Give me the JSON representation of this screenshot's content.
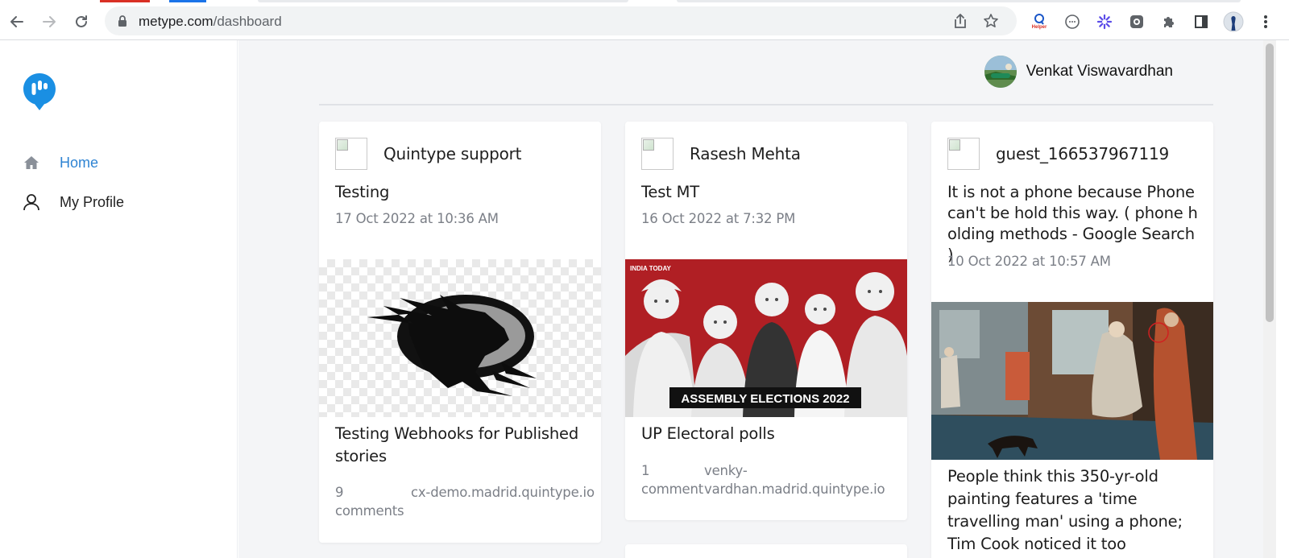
{
  "browser": {
    "url_domain": "metype.com",
    "url_path": "/dashboard",
    "ext_badge": "Helper"
  },
  "sidebar": {
    "items": [
      {
        "label": "Home",
        "icon": "home-icon",
        "active": true
      },
      {
        "label": "My Profile",
        "icon": "user-icon",
        "active": false
      }
    ]
  },
  "header": {
    "user_name": "Venkat Viswavardhan"
  },
  "cards": [
    {
      "author": "Quintype support",
      "title": "Testing",
      "date": "17 Oct 2022 at 10:36 AM",
      "story_title": "Testing Webhooks for Published stories",
      "comments": "9 comments",
      "domain": "cx-demo.madrid.quintype.io"
    },
    {
      "author": "Rasesh Mehta",
      "title": "Test MT",
      "date": "16 Oct 2022 at 7:32 PM",
      "image_caption": "ASSEMBLY ELECTIONS 2022",
      "image_brand": "INDIA TODAY",
      "story_title": "UP Electoral polls",
      "comments": "1 comment",
      "domain": "venky-vardhan.madrid.quintype.io"
    },
    {
      "author": "guest_166537967119",
      "title": "It is not a phone because Phone can't be hold this way. ( phone h olding methods - Google Search )",
      "date": "10 Oct 2022 at 10:57 AM",
      "story_title": "People think this 350-yr-old painting features a 'time travelling man' using a phone; Tim Cook noticed it too"
    }
  ],
  "colors": {
    "accent": "#2f84d3",
    "logo": "#1a8fe3",
    "background": "#f4f5f7",
    "muted_text": "#7b7f87"
  }
}
